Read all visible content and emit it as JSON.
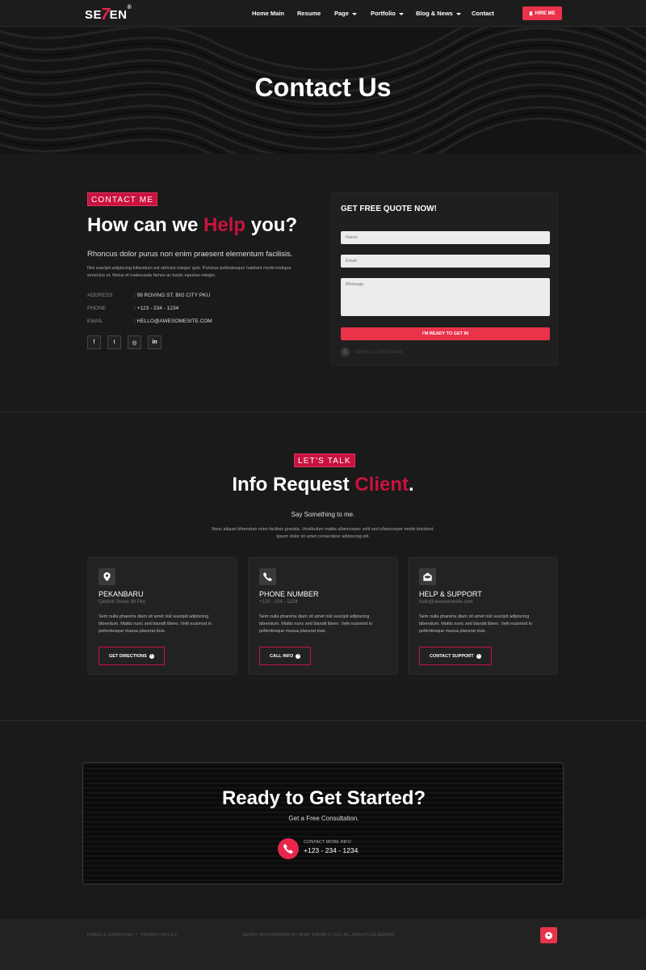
{
  "header": {
    "logo_prefix": "SE",
    "logo_seven": "7",
    "logo_suffix": "EN",
    "logo_mark": "®",
    "nav": [
      "Home Main",
      "Resume",
      "Page",
      "Portfolio",
      "Blog & News",
      "Contact"
    ],
    "hire_label": "HIRE ME"
  },
  "hero": {
    "title": "Contact Us"
  },
  "contact": {
    "badge": "CONTACT ME",
    "heading_before": "How can we ",
    "heading_accent": "Help",
    "heading_after": " you?",
    "lead": "Rhoncus dolor purus non enim praesent elementum facilisis.",
    "body_line1": "Nisl suscipit adipiscing bibendum est ultricies integer quis. Pulvinar pellentesque habitant morbi tristique",
    "body_line2": "senectus et. Netus et malesuada fames ac turpis egestas integer.",
    "address_label": "ADDRESS",
    "address_value": "99 ROVING ST. BIG CITY PKU",
    "phone_label": "PHONE",
    "phone_value": "+123 - 234 - 1234",
    "email_label": "EMAIL",
    "email_value": "HELLO@AWESOMESITE.COM",
    "social_icons": [
      "facebook-icon",
      "twitter-icon",
      "instagram-icon",
      "linkedin-icon"
    ],
    "social_glyphs": [
      "f",
      "t",
      "◎",
      "in"
    ]
  },
  "quote": {
    "title": "GET FREE QUOTE NOW!",
    "name_placeholder": "Name",
    "email_placeholder": "Email",
    "message_placeholder": "Message",
    "submit": "I'M READY TO GET IN",
    "terms": "TERMS & CONDITIONS",
    "terms_glyph": "i"
  },
  "info": {
    "badge": "LET'S TALK",
    "heading_before": "Info Request ",
    "heading_accent": "Client",
    "heading_after": ".",
    "say": "Say Something to me.",
    "body_line1": "Nunc aliquet bibendum enim facilisis gravida. Vestibulum mattis ullamcorper velit sed ullamcorper morbi tincidunt.",
    "body_line2": "Ipsum dolor sit amet consectetur adipiscing elit.",
    "cards": [
      {
        "icon": "location-pin-icon",
        "title": "PEKANBARU",
        "sub": "Qetilink Street 99 Pku",
        "text": "Sem nulla pharetra diam sit amet nisl suscipit adipiscing bibendum. Mattis nunc sed blandit libero. Velit euismod in pellentesque massa placerat duis.",
        "button": "GET DIRECTIONS"
      },
      {
        "icon": "phone-icon",
        "title": "PHONE NUMBER",
        "sub": "+123 - 234 - 1234",
        "text": "Sem nulla pharetra diam sit amet nisl suscipit adipiscing bibendum. Mattis nunc sed blandit libero. Velit euismod in pellentesque massa placerat duis.",
        "button": "CALL INFO"
      },
      {
        "icon": "envelope-open-icon",
        "title": "HELP & SUPPORT",
        "sub": "hello@awesomesite.com",
        "text": "Sem nulla pharetra diam sit amet nisl suscipit adipiscing bibendum. Mattis nunc sed blandit libero. Velit euismod in pellentesque massa placerat duis.",
        "button": "CONTACT SUPPORT"
      }
    ]
  },
  "ready": {
    "title": "Ready to Get Started?",
    "sub": "Get a Free Consultation.",
    "contact_label": "CONTACT MORE INFO",
    "phone": "+123 - 234 - 1234"
  },
  "footer": {
    "links": [
      "TERMS & CONDITION",
      "|",
      "PRIVACY POLICY"
    ],
    "copyright": "SEVEN WITH PASSION BY BOMI THEME © 2021 ALL RIGHTS RESERVED"
  },
  "colors": {
    "accent": "#c8123f",
    "button": "#e8334b",
    "background": "#1a1a1a"
  }
}
